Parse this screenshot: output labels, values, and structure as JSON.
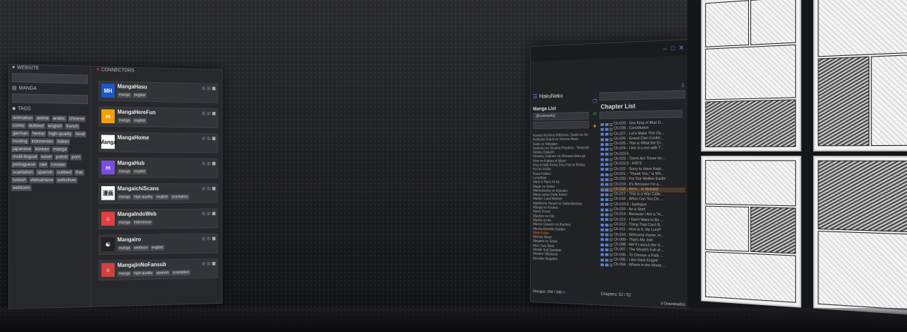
{
  "left": {
    "website_label": "WEBSITE",
    "manga_label": "MANGA",
    "tags_label": "TAGS",
    "connectors_label": "CONNECTORS",
    "tags": [
      "animation",
      "anime",
      "arabic",
      "chinese",
      "comic",
      "dubbed",
      "english",
      "french",
      "german",
      "hentai",
      "high-quality",
      "hindi",
      "hosting",
      "indonesian",
      "italian",
      "japanese",
      "korean",
      "manga",
      "multi-lingual",
      "novel",
      "polish",
      "porn",
      "portuguese",
      "raw",
      "russian",
      "scanlation",
      "spanish",
      "subbed",
      "thai",
      "turkish",
      "vietnamese",
      "webshow",
      "webtoon"
    ],
    "connectors": [
      {
        "name": "MangaHasu",
        "logo": "MH",
        "logo_color": "#1a57c8",
        "tags": [
          "manga",
          "english"
        ]
      },
      {
        "name": "MangaHereFun",
        "logo": "m",
        "logo_color": "#f2a000",
        "tags": [
          "manga",
          "english"
        ]
      },
      {
        "name": "MangaHome",
        "logo": "Manga",
        "logo_color": "#ffffff",
        "tags": []
      },
      {
        "name": "MangaHub",
        "logo": "m",
        "logo_color": "#7a4de0",
        "tags": [
          "manga",
          "english"
        ]
      },
      {
        "name": "MangaichiScans",
        "logo": "漫画",
        "logo_color": "#ffffff",
        "tags": [
          "manga",
          "high-quality",
          "english",
          "scanlation"
        ]
      },
      {
        "name": "MangaIndoWeb",
        "logo": "☺",
        "logo_color": "#e04040",
        "tags": [
          "manga",
          "indonesian"
        ]
      },
      {
        "name": "Mangairo",
        "logo": "☯",
        "logo_color": "#222222",
        "tags": [
          "manga",
          "webtoon",
          "english"
        ]
      },
      {
        "name": "MangajinNoFansub",
        "logo": "☺",
        "logo_color": "#d04040",
        "tags": [
          "manga",
          "high-quality",
          "spanish",
          "scanlation"
        ]
      }
    ]
  },
  "hakuneko": {
    "title": "HakuNeko",
    "manga_list_label": "Manga List",
    "manga_filter": "[Bookmarks]",
    "chapter_list_label": "Chapter List",
    "manga_count": "Mangas: 398 / 398",
    "chapter_count": "Chapters: 52 / 52",
    "downloads": "0 Download(s)",
    "mangas": [
      "Kanojo Kichirou Hitotsuru: Daeki no Jin",
      "Kaitouko Kakai no Yoromo Anon",
      "Kaito no Shiyaten",
      "Kemono no Sousou Pandora - Tensoshi",
      "Kidoku Gakuen",
      "Kimetsu Gakuen no Shouwa desu ga",
      "Kimi no Kaikou ni Maze",
      "Kiss to Nah Kotsu Dou Fuki to Bokka",
      "Koi no Ichika",
      "Kusu Fudaru",
      "Leviathan",
      "Maai ni Naru no ka",
      "Magic no Sekai",
      "Mahoutsukai no Kyouiku",
      "Maou-sama Datte Kotori",
      "Maiden Land Meister",
      "Makikomo Tensei no Sabonfantasy",
      "Manga no Koukai",
      "Marry Grave",
      "Mashiro no Oto",
      "Masho no Ao",
      "Mazou Gakuen no Kochira",
      "Mecha Kenshin Kaiden",
      "Meiji Kiritan",
      "Melody Moon",
      "Megami no Sekai",
      "Mon Yura Siete",
      "Mobile Suit Gundam",
      "Modern Villainess",
      "Monster Kingdom"
    ],
    "selected_manga_index": 23,
    "chapters": [
      "Ch.029 - Sea King of Blue D...",
      "Ch.028 - Constitution",
      "Ch.027 - Let's Make This Ou...",
      "Ch.026 - Grand Clan Confer...",
      "Ch.025 - This is What the Er...",
      "Ch.024 - I Am in Love with T...",
      "Ch.023.5",
      "Ch.023 - There Are Times for...",
      "Ch.022.5 - RATS",
      "Ch.022 - Sorry to Have Kept...",
      "Ch.021 - \"Thank You,\" is Wh...",
      "Ch.020 - For Our Mother Earth!",
      "Ch.019 - It's Because I'm a...",
      "Ch.018 - Hero... is Needed",
      "Ch.017 - This is a War Calle...",
      "Ch.016 - What Can You Do ...",
      "Ch.015.5 - Epilogue",
      "Ch.015 - As a Start",
      "Ch.014 - Because I Am a \"H...",
      "Ch.013 - I Don't Want to Be ...",
      "Ch.012 - Thing That Can't B...",
      "Ch.011 - How is It, My Lord?",
      "Ch.010 - Welcome Home, H...",
      "Ch.009 - That's My Job!",
      "Ch.008 - We'll Launch the S...",
      "Ch.007 - The World's Full of ...",
      "Ch.006 - To Choose a Path ...",
      "Ch.005 - I Am Dark Knight!",
      "Ch.004 - Where in the World ..."
    ],
    "selected_chapter_index": 13
  }
}
